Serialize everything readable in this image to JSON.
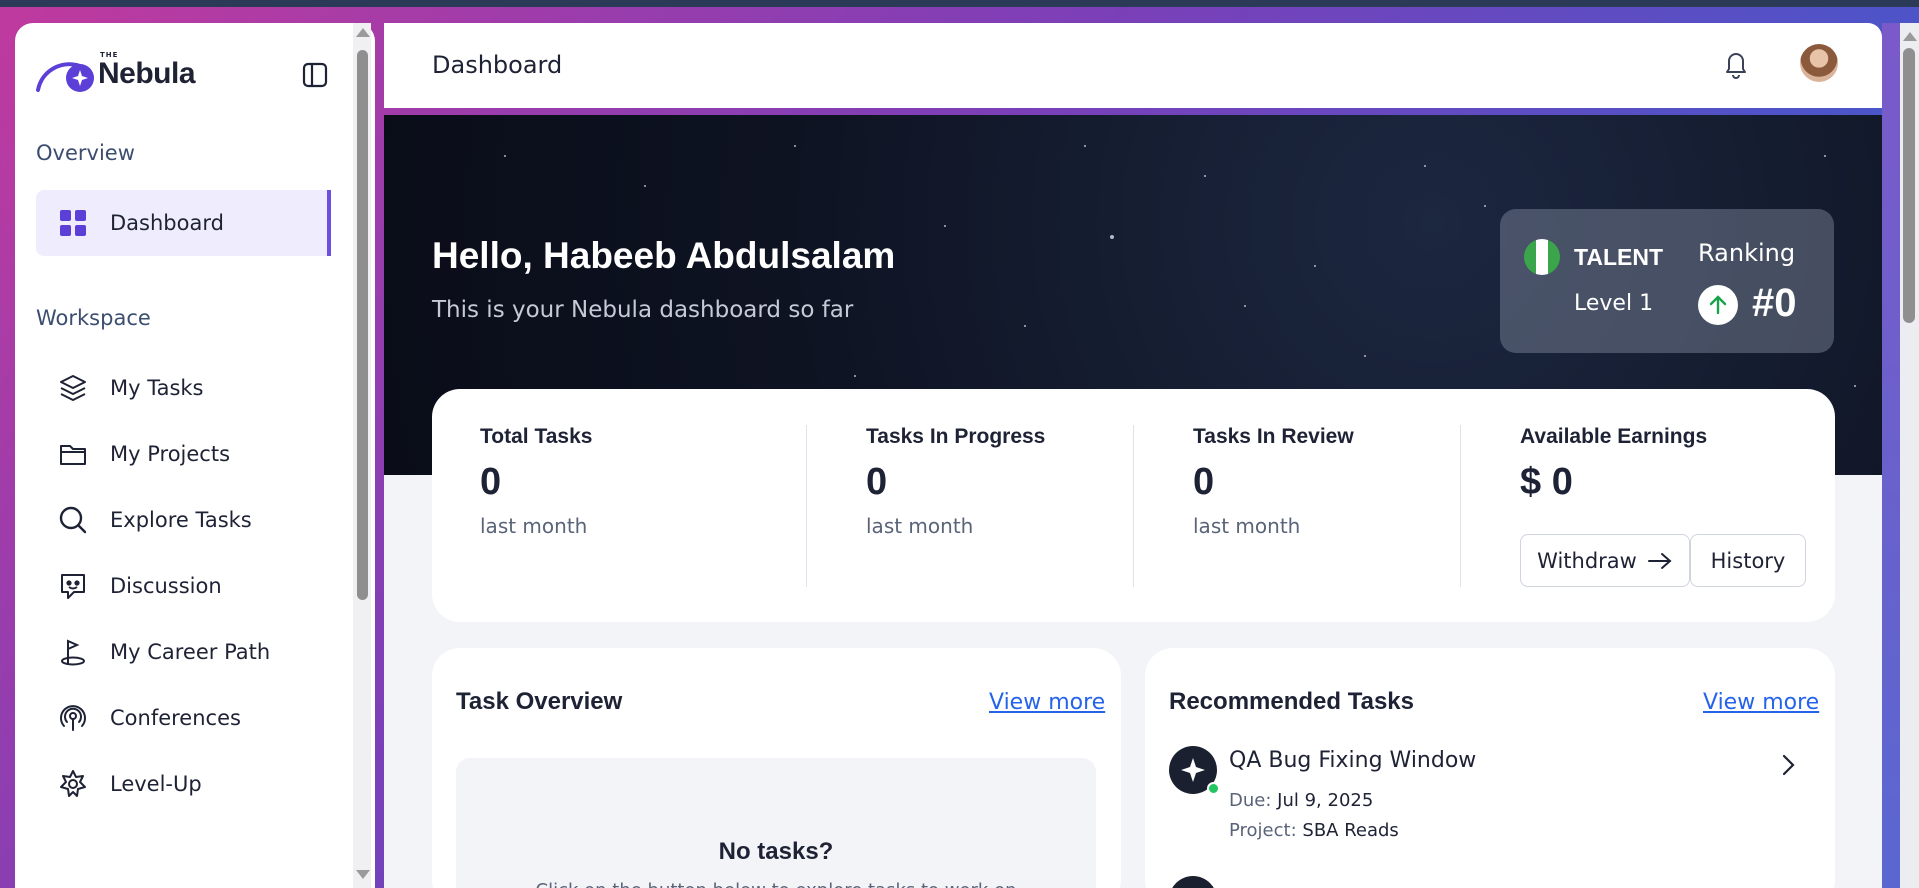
{
  "sidebar": {
    "logo": {
      "small": "THE",
      "name": "Nebula"
    },
    "sections": [
      {
        "label": "Overview"
      },
      {
        "label": "Workspace"
      }
    ],
    "items": [
      {
        "label": "Dashboard",
        "icon": "grid-icon",
        "active": true
      },
      {
        "label": "My Tasks",
        "icon": "layers-icon"
      },
      {
        "label": "My Projects",
        "icon": "folder-icon"
      },
      {
        "label": "Explore Tasks",
        "icon": "search-icon"
      },
      {
        "label": "Discussion",
        "icon": "chat-bot-icon"
      },
      {
        "label": "My Career Path",
        "icon": "career-path-icon"
      },
      {
        "label": "Conferences",
        "icon": "broadcast-icon"
      },
      {
        "label": "Level-Up",
        "icon": "star-badge-icon"
      }
    ]
  },
  "header": {
    "title": "Dashboard"
  },
  "hero": {
    "greeting": "Hello, Habeeb Abdulsalam",
    "subtitle": "This is your Nebula dashboard so far",
    "rank": {
      "badge": "TALENT",
      "level": "Level 1",
      "ranking_label": "Ranking",
      "ranking_value": "#0"
    }
  },
  "stats": [
    {
      "label": "Total Tasks",
      "value": "0",
      "sub": "last month"
    },
    {
      "label": "Tasks In Progress",
      "value": "0",
      "sub": "last month"
    },
    {
      "label": "Tasks In Review",
      "value": "0",
      "sub": "last month"
    },
    {
      "label": "Available Earnings",
      "value": "$ 0"
    }
  ],
  "earnings_buttons": {
    "withdraw": "Withdraw",
    "history": "History"
  },
  "task_overview": {
    "title": "Task Overview",
    "view_more": "View more",
    "empty_title": "No tasks?",
    "empty_sub": "Click on the button below to explore tasks to work on"
  },
  "recommended": {
    "title": "Recommended Tasks",
    "view_more": "View more",
    "tasks": [
      {
        "title": "QA Bug Fixing Window",
        "due_label": "Due:",
        "due": "Jul 9, 2025",
        "project_label": "Project:",
        "project": "SBA Reads"
      }
    ]
  },
  "colors": {
    "accent": "#6a4fe0",
    "link": "#2563eb",
    "online": "#22c55e"
  }
}
